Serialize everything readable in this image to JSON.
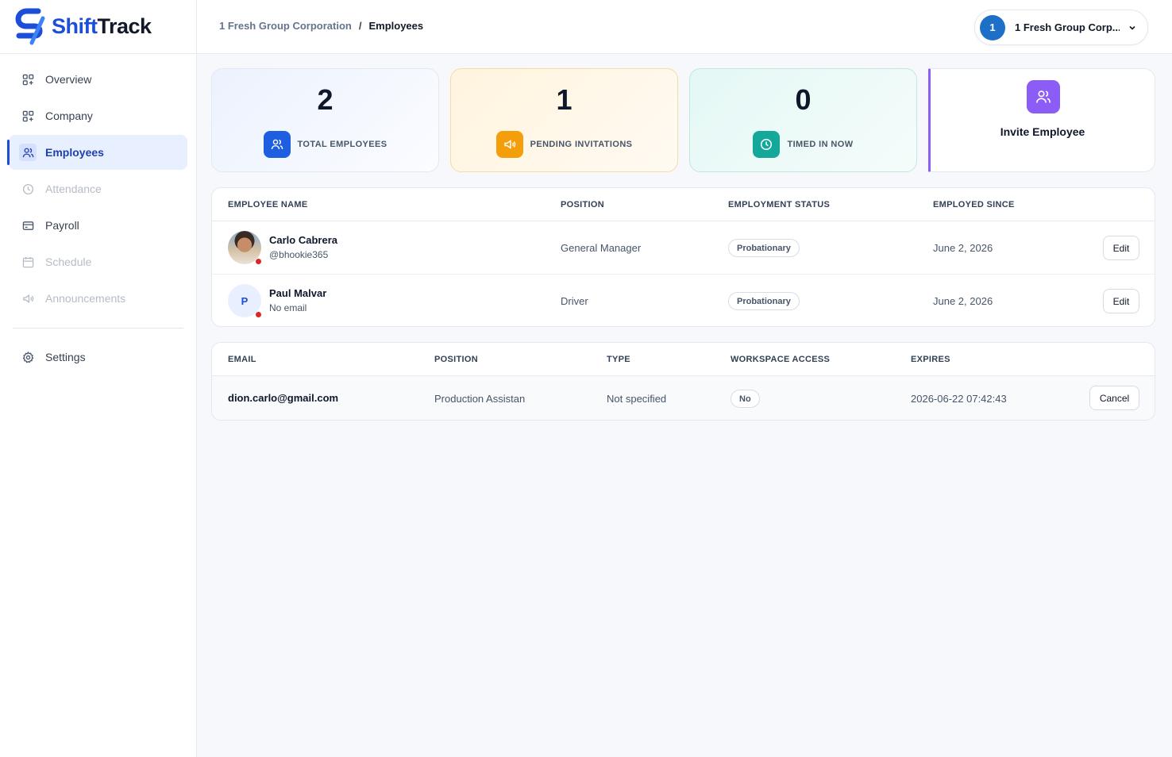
{
  "app": {
    "logo_first": "Shift",
    "logo_second": "Track"
  },
  "sidebar": {
    "items": [
      {
        "label": "Overview",
        "icon": "grid-plus-icon",
        "state": "normal"
      },
      {
        "label": "Company",
        "icon": "grid-plus-icon",
        "state": "normal"
      },
      {
        "label": "Employees",
        "icon": "users-icon",
        "state": "active"
      },
      {
        "label": "Attendance",
        "icon": "clock-icon",
        "state": "disabled"
      },
      {
        "label": "Payroll",
        "icon": "credit-card-icon",
        "state": "normal"
      },
      {
        "label": "Schedule",
        "icon": "calendar-icon",
        "state": "disabled"
      },
      {
        "label": "Announcements",
        "icon": "megaphone-icon",
        "state": "disabled"
      }
    ],
    "settings_label": "Settings"
  },
  "header": {
    "breadcrumb_parent": "1 Fresh Group Corporation",
    "breadcrumb_sep": "/",
    "breadcrumb_current": "Employees",
    "org_initial": "1",
    "org_name": "1 Fresh Group Corp..."
  },
  "stats": {
    "total_employees": {
      "value": "2",
      "label": "TOTAL EMPLOYEES"
    },
    "pending_invitations": {
      "value": "1",
      "label": "PENDING INVITATIONS"
    },
    "timed_in_now": {
      "value": "0",
      "label": "TIMED IN NOW"
    },
    "invite_label": "Invite Employee"
  },
  "employees_table": {
    "headers": {
      "name": "EMPLOYEE NAME",
      "position": "POSITION",
      "status": "EMPLOYMENT STATUS",
      "since": "EMPLOYED SINCE"
    },
    "rows": [
      {
        "name": "Carlo Cabrera",
        "sub": "@bhookie365",
        "position": "General Manager",
        "status": "Probationary",
        "since": "June 2, 2026",
        "action": "Edit"
      },
      {
        "name": "Paul Malvar",
        "sub": "No email",
        "initial": "P",
        "position": "Driver",
        "status": "Probationary",
        "since": "June 2, 2026",
        "action": "Edit"
      }
    ]
  },
  "invitations_table": {
    "headers": {
      "email": "EMAIL",
      "position": "POSITION",
      "type": "TYPE",
      "access": "WORKSPACE ACCESS",
      "expires": "EXPIRES"
    },
    "rows": [
      {
        "email": "dion.carlo@gmail.com",
        "position": "Production Assistan",
        "type": "Not specified",
        "access": "No",
        "expires": "2026-06-22 07:42:43",
        "action": "Cancel"
      }
    ]
  },
  "colors": {
    "brand": "#1d4ed8",
    "blue_badge": "#1d5fe0",
    "orange_badge": "#f59e0b",
    "teal_badge": "#14a89a",
    "purple_accent": "#8b5cf6",
    "status_dot": "#dc2626"
  }
}
